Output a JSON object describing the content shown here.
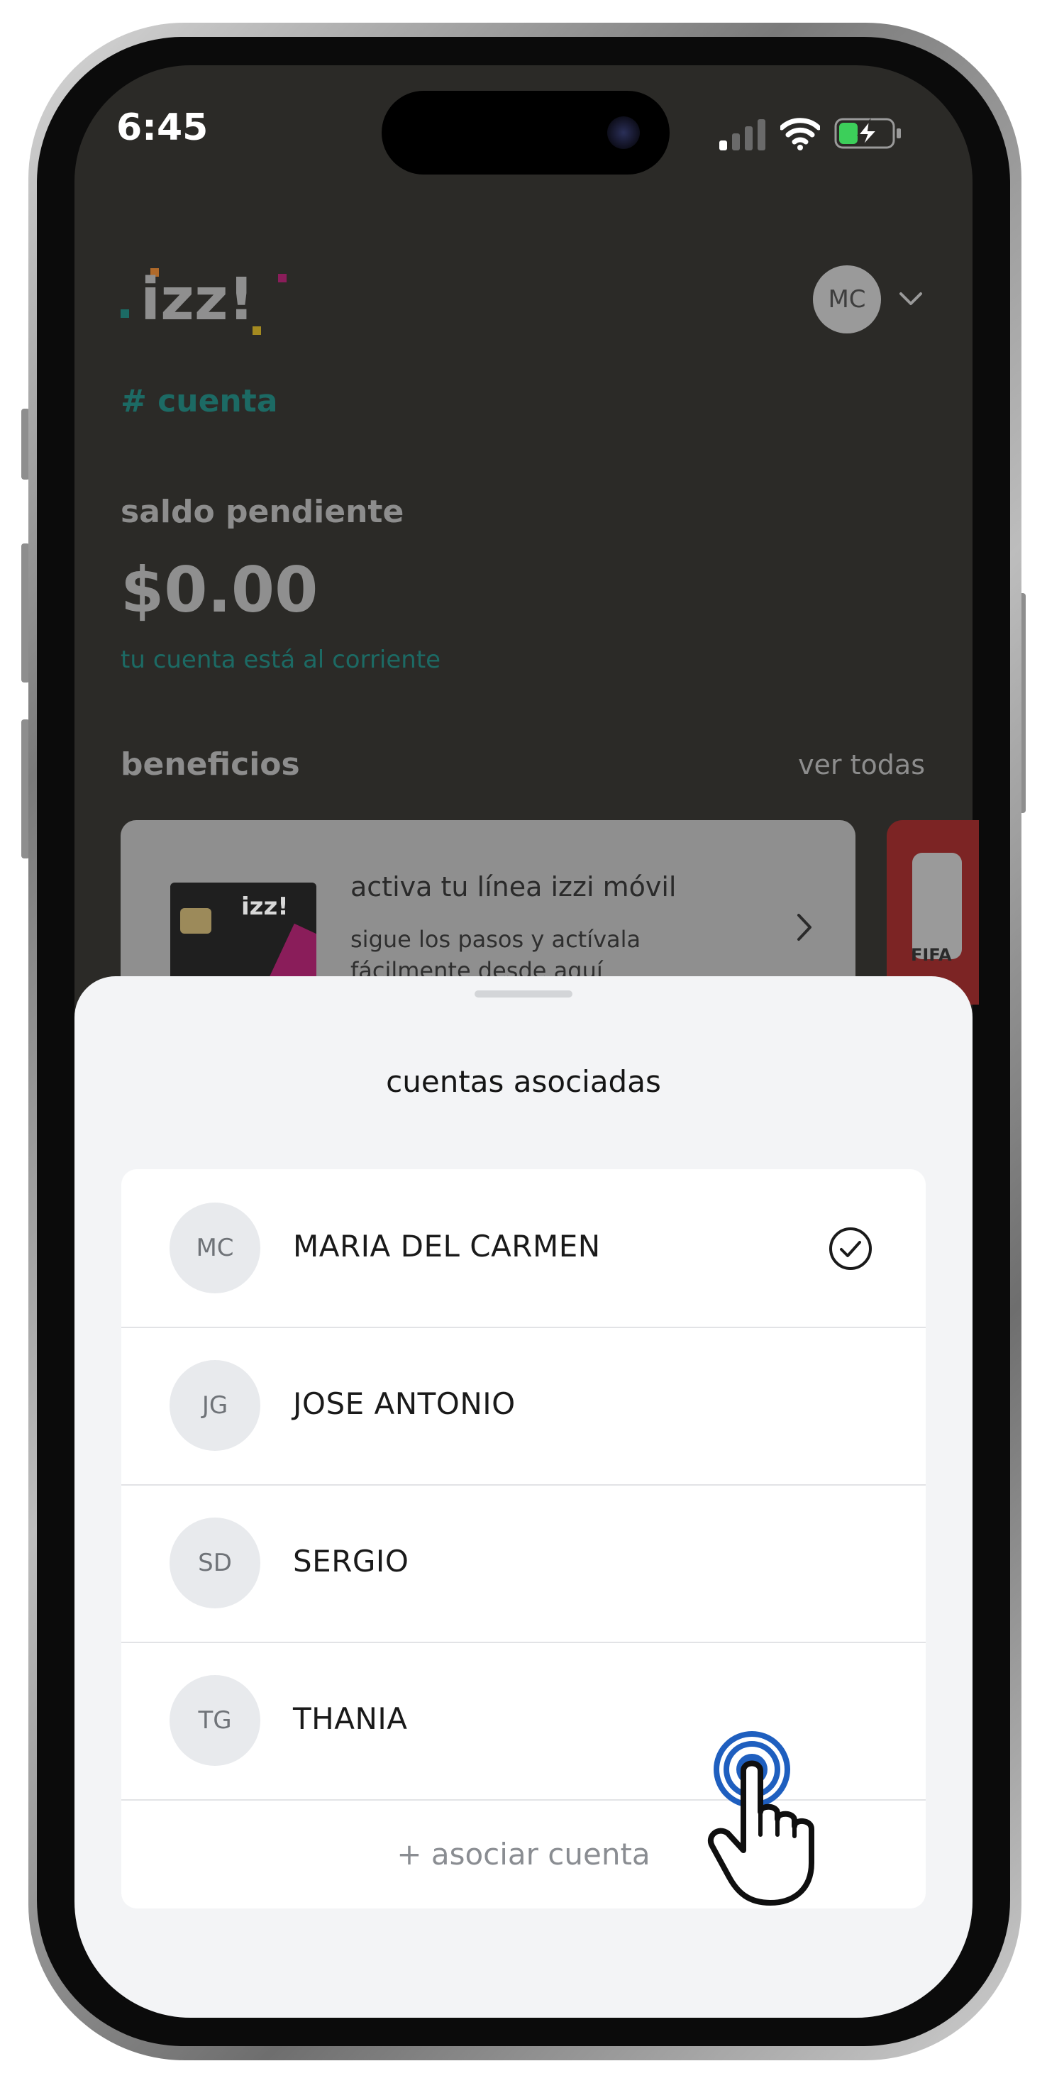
{
  "status_bar": {
    "time": "6:45",
    "icons": [
      "signal-icon",
      "wifi-icon",
      "battery-charging-icon"
    ]
  },
  "header": {
    "brand": ".izz!",
    "account_initials": "MC",
    "section_title": "# cuenta"
  },
  "balance": {
    "label": "saldo pendiente",
    "amount": "$0.00",
    "status": "tu cuenta está al corriente"
  },
  "benefits": {
    "label": "beneficios",
    "see_all": "ver todas",
    "cards": [
      {
        "title": "activa tu línea izzi móvil",
        "subtitle": "sigue los pasos y actívala fácilmente desde aquí",
        "image_brand": "izz!"
      },
      {
        "badge": "FIFA"
      }
    ]
  },
  "sheet": {
    "title": "cuentas asociadas",
    "accounts": [
      {
        "initials": "MC",
        "name": "MARIA DEL CARMEN",
        "selected": true
      },
      {
        "initials": "JG",
        "name": "JOSE ANTONIO",
        "selected": false
      },
      {
        "initials": "SD",
        "name": "SERGIO",
        "selected": false
      },
      {
        "initials": "TG",
        "name": "THANIA",
        "selected": false
      }
    ],
    "add_label": "+ asociar cuenta"
  },
  "colors": {
    "accent_teal": "#1c6a64",
    "tap_indicator": "#1f5fbf",
    "background_dim": "#2b2a27"
  }
}
